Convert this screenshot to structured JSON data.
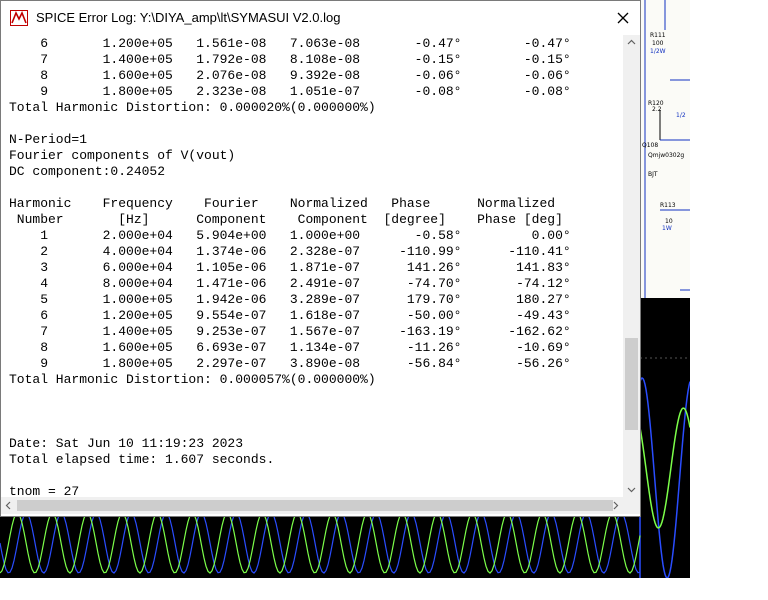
{
  "window": {
    "title": "SPICE Error Log: Y:\\DIYA_amp\\lt\\SYMASUI V2.0.log",
    "close_symbol": "✕"
  },
  "schematic": {
    "labels": [
      "R111",
      "100",
      "1/2W",
      "R120",
      "2.2",
      "1/2",
      "Q108",
      "Qmjw0302g",
      "BJT",
      "R113",
      "10",
      "1W"
    ]
  },
  "log_lines": [
    "    6       1.200e+05   1.561e-08   7.063e-08       -0.47°        -0.47°",
    "    7       1.400e+05   1.792e-08   8.108e-08       -0.15°        -0.15°",
    "    8       1.600e+05   2.076e-08   9.392e-08       -0.06°        -0.06°",
    "    9       1.800e+05   2.323e-08   1.051e-07       -0.08°        -0.08°",
    "Total Harmonic Distortion: 0.000020%(0.000000%)",
    "",
    "N-Period=1",
    "Fourier components of V(vout)",
    "DC component:0.24052",
    "",
    "Harmonic    Frequency    Fourier    Normalized   Phase      Normalized",
    " Number       [Hz]      Component    Component  [degree]    Phase [deg]",
    "    1       2.000e+04   5.904e+00   1.000e+00       -0.58°         0.00°",
    "    2       4.000e+04   1.374e-06   2.328e-07     -110.99°      -110.41°",
    "    3       6.000e+04   1.105e-06   1.871e-07      141.26°       141.83°",
    "    4       8.000e+04   1.471e-06   2.491e-07      -74.70°       -74.12°",
    "    5       1.000e+05   1.942e-06   3.289e-07      179.70°       180.27°",
    "    6       1.200e+05   9.554e-07   1.618e-07      -50.00°       -49.43°",
    "    7       1.400e+05   9.253e-07   1.567e-07     -163.19°      -162.62°",
    "    8       1.600e+05   6.693e-07   1.134e-07      -11.26°       -10.69°",
    "    9       1.800e+05   2.297e-07   3.890e-08      -56.84°       -56.26°",
    "Total Harmonic Distortion: 0.000057%(0.000000%)",
    "",
    "",
    "",
    "Date: Sat Jun 10 11:19:23 2023",
    "Total elapsed time: 1.607 seconds.",
    "",
    "tnom = 27"
  ],
  "colors": {
    "plot_background": "#000000",
    "trace_blue": "#2a4dff",
    "trace_green": "#7cff4a",
    "schematic_wire": "#1030c0"
  }
}
